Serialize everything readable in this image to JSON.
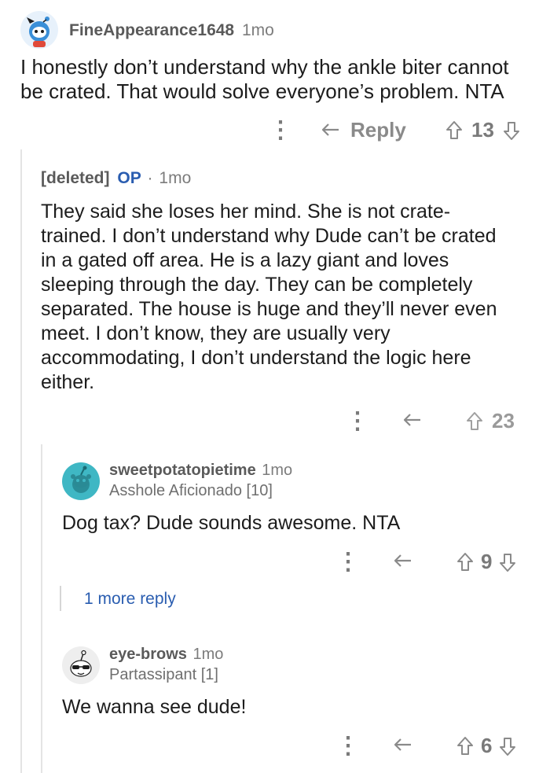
{
  "comments": [
    {
      "username": "FineAppearance1648",
      "time": "1mo",
      "body": "I honestly don’t understand why the ankle biter cannot be crated. That would solve everyone’s problem. NTA",
      "reply_label": "Reply",
      "score": "13"
    },
    {
      "username": "[deleted]",
      "op_label": "OP",
      "separator": "·",
      "time": "1mo",
      "body": "They said she loses her mind. She is not crate-trained. I don’t understand why Dude can’t be crated in a gated off area. He is a lazy giant and loves sleeping through the day. They can be completely separated. The house is huge and they’ll never even meet. I don’t know, they are usually very accommodating, I don’t understand the logic here either.",
      "score": "23"
    },
    {
      "username": "sweetpotatopietime",
      "time": "1mo",
      "flair": "Asshole Aficionado [10]",
      "body": "Dog tax? Dude sounds awesome. NTA",
      "score": "9"
    },
    {
      "more_replies": "1 more reply"
    },
    {
      "username": "eye-brows",
      "time": "1mo",
      "flair": "Partassipant [1]",
      "body": "We wanna see dude!",
      "score": "6"
    }
  ],
  "colors": {
    "accent_blue": "#2a5db0",
    "muted": "#8a8a8a",
    "thread_line": "#e4e4e4",
    "avatar_teal": "#3fb7c4",
    "avatar_blue": "#3a8fd8"
  },
  "icons": [
    "more-dots-icon",
    "reply-arrow-icon",
    "upvote-icon",
    "downvote-icon",
    "snoo-avatar-icon"
  ]
}
